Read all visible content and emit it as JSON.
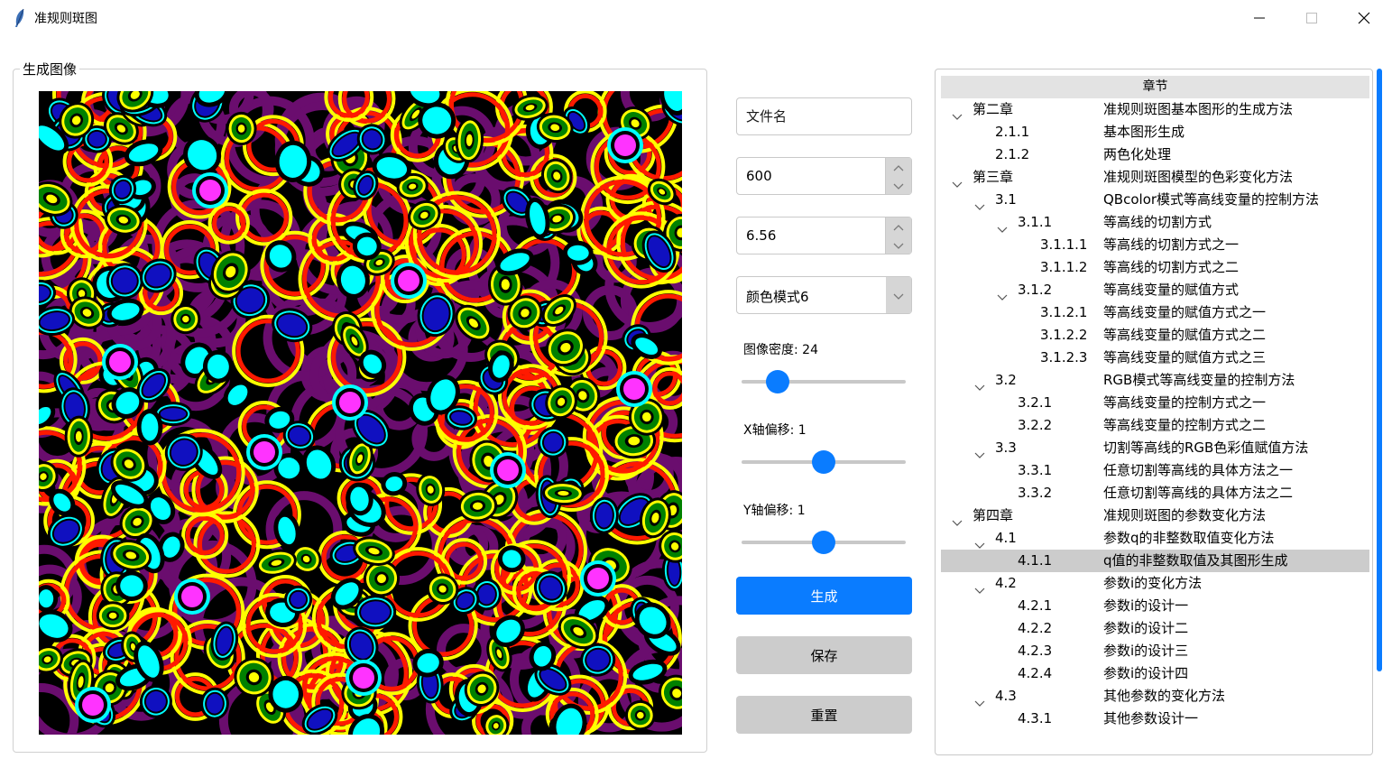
{
  "window": {
    "title": "准规则斑图"
  },
  "left_panel": {
    "group_title": "生成图像",
    "image_name": "quasi-regular pattern image"
  },
  "controls": {
    "filename": {
      "value": "",
      "placeholder": "文件名"
    },
    "size": {
      "value": "600"
    },
    "param": {
      "value": "6.56"
    },
    "color_mode": {
      "selected": "颜色模式6"
    },
    "density": {
      "label": "图像密度: 24",
      "value": 24,
      "fraction": 0.22
    },
    "x_offset": {
      "label": "X轴偏移: 1",
      "value": 1,
      "fraction": 0.5
    },
    "y_offset": {
      "label": "Y轴偏移: 1",
      "value": 1,
      "fraction": 0.5
    },
    "generate_label": "生成",
    "save_label": "保存",
    "reset_label": "重置"
  },
  "tree": {
    "header": "章节",
    "rows": [
      {
        "id": "第二章",
        "title": "准规则斑图基本图形的生成方法",
        "level": 0,
        "expanded": true
      },
      {
        "id": "2.1.1",
        "title": "基本图形生成",
        "level": 1,
        "leaf": true
      },
      {
        "id": "2.1.2",
        "title": "两色化处理",
        "level": 1,
        "leaf": true
      },
      {
        "id": "第三章",
        "title": "准规则斑图模型的色彩变化方法",
        "level": 0,
        "expanded": true
      },
      {
        "id": "3.1",
        "title": "QBcolor模式等高线变量的控制方法",
        "level": 1,
        "expanded": true
      },
      {
        "id": "3.1.1",
        "title": "等高线的切割方式",
        "level": 2,
        "expanded": true
      },
      {
        "id": "3.1.1.1",
        "title": "等高线的切割方式之一",
        "level": 3,
        "leaf": true
      },
      {
        "id": "3.1.1.2",
        "title": "等高线的切割方式之二",
        "level": 3,
        "leaf": true
      },
      {
        "id": "3.1.2",
        "title": "等高线变量的赋值方式",
        "level": 2,
        "expanded": true
      },
      {
        "id": "3.1.2.1",
        "title": "等高线变量的赋值方式之一",
        "level": 3,
        "leaf": true
      },
      {
        "id": "3.1.2.2",
        "title": "等高线变量的赋值方式之二",
        "level": 3,
        "leaf": true
      },
      {
        "id": "3.1.2.3",
        "title": "等高线变量的赋值方式之三",
        "level": 3,
        "leaf": true
      },
      {
        "id": "3.2",
        "title": "RGB模式等高线变量的控制方法",
        "level": 1,
        "expanded": true
      },
      {
        "id": "3.2.1",
        "title": "等高线变量的控制方式之一",
        "level": 2,
        "leaf": true
      },
      {
        "id": "3.2.2",
        "title": "等高线变量的控制方式之二",
        "level": 2,
        "leaf": true
      },
      {
        "id": "3.3",
        "title": "切割等高线的RGB色彩值赋值方法",
        "level": 1,
        "expanded": true
      },
      {
        "id": "3.3.1",
        "title": "任意切割等高线的具体方法之一",
        "level": 2,
        "leaf": true
      },
      {
        "id": "3.3.2",
        "title": "任意切割等高线的具体方法之二",
        "level": 2,
        "leaf": true
      },
      {
        "id": "第四章",
        "title": "准规则斑图的参数变化方法",
        "level": 0,
        "expanded": true
      },
      {
        "id": "4.1",
        "title": "参数q的非整数取值变化方法",
        "level": 1,
        "expanded": true
      },
      {
        "id": "4.1.1",
        "title": "q值的非整数取值及其图形生成",
        "level": 2,
        "leaf": true,
        "selected": true
      },
      {
        "id": "4.2",
        "title": "参数i的变化方法",
        "level": 1,
        "expanded": true
      },
      {
        "id": "4.2.1",
        "title": "参数i的设计一",
        "level": 2,
        "leaf": true
      },
      {
        "id": "4.2.2",
        "title": "参数i的设计二",
        "level": 2,
        "leaf": true
      },
      {
        "id": "4.2.3",
        "title": "参数i的设计三",
        "level": 2,
        "leaf": true
      },
      {
        "id": "4.2.4",
        "title": "参数i的设计四",
        "level": 2,
        "leaf": true
      },
      {
        "id": "4.3",
        "title": "其他参数的变化方法",
        "level": 1,
        "expanded": true
      },
      {
        "id": "4.3.1",
        "title": "其他参数设计一",
        "level": 2,
        "leaf": true
      }
    ]
  },
  "colors": {
    "accent": "#0a7cff",
    "button_gray": "#cccccc",
    "selection": "#cccccc"
  },
  "icons": {
    "app": "feather-icon",
    "minimize": "minimize-icon",
    "maximize": "maximize-icon",
    "close": "close-icon"
  }
}
